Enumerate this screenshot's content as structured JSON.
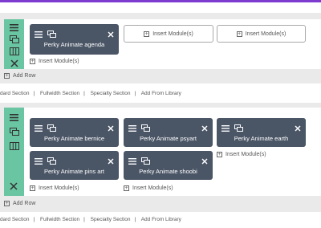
{
  "sections": [
    {
      "modules": [
        {
          "title": "Perky Animate agenda"
        }
      ],
      "insert_label": "Insert Module(s)",
      "add_row": "Add Row"
    },
    {
      "modules": [
        {
          "title": "Perky Animate bernice"
        },
        {
          "title": "Perky Animate psyart"
        },
        {
          "title": "Perky Animate earth"
        },
        {
          "title": "Perky Animate pins art"
        },
        {
          "title": "Perky Animate shoobi"
        }
      ],
      "insert_label": "Insert Module(s)",
      "add_row": "Add Row"
    }
  ],
  "links": [
    "dard Section",
    "Fullwidth Section",
    "Specialty Section",
    "Add From Library"
  ],
  "colors": {
    "handle": "#6ac5a2",
    "module": "#4a5566",
    "topbar": "#7e3bd0"
  }
}
